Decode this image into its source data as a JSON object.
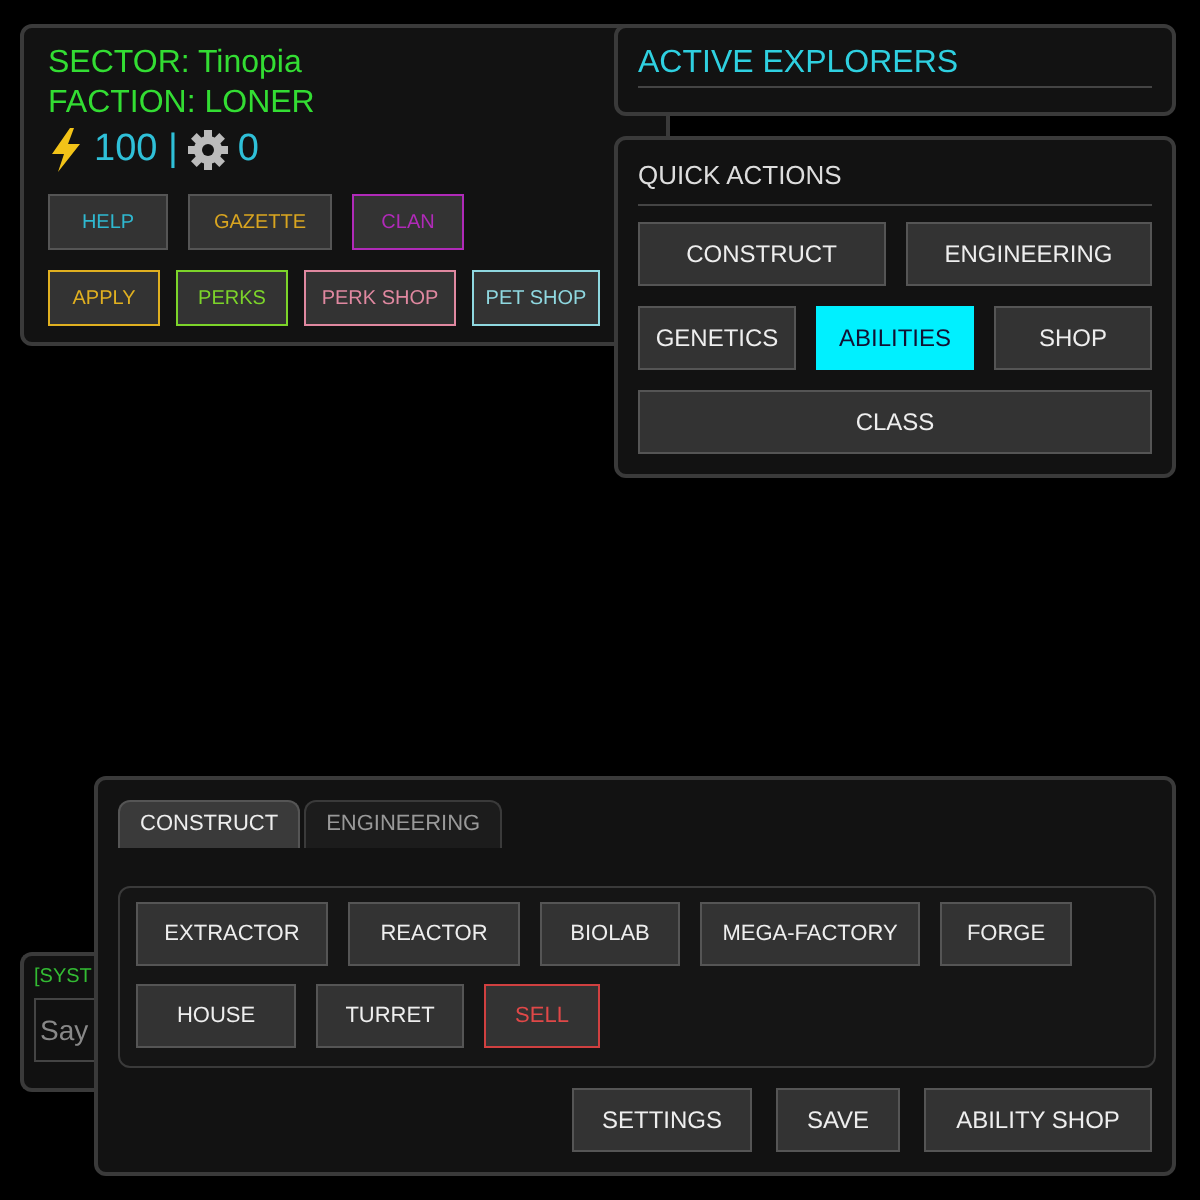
{
  "status_panel": {
    "sector": "SECTOR: Tinopia",
    "faction": "FACTION: LONER",
    "energy": "100 |",
    "gears": "0",
    "buttons": [
      {
        "label": "HELP",
        "outlined": false
      },
      {
        "label": "GAZETTE",
        "outlined": false
      },
      {
        "label": "CLAN",
        "outlined": true
      }
    ],
    "buttons_row2": [
      {
        "label": "APPLY",
        "color": "#e0b020"
      },
      {
        "label": "PERKS",
        "color": "#7cd42a"
      },
      {
        "label": "PERK SHOP",
        "color": "#e088a0"
      },
      {
        "label": "PET SHOP",
        "color": "#8fd8e0"
      }
    ]
  },
  "explorers_panel": {
    "title": "ACTIVE EXPLORERS"
  },
  "quick_actions": {
    "title": "QUICK ACTIONS",
    "buttons": [
      {
        "label": "CONSTRUCT",
        "selected": false
      },
      {
        "label": "ENGINEERING",
        "selected": false
      },
      {
        "label": "GENETICS",
        "selected": false
      },
      {
        "label": "ABILITIES",
        "selected": true
      },
      {
        "label": "SHOP",
        "selected": false
      },
      {
        "label": "CLASS",
        "selected": false
      }
    ]
  },
  "chat_panel": {
    "message": "[SYST",
    "placeholder": "Say"
  },
  "construct_panel": {
    "tabs": [
      {
        "label": "CONSTRUCT",
        "selected": true
      },
      {
        "label": "ENGINEERING",
        "selected": false
      }
    ],
    "items": [
      {
        "label": "EXTRACTOR",
        "kind": "build"
      },
      {
        "label": "REACTOR",
        "kind": "build"
      },
      {
        "label": "BIOLAB",
        "kind": "build"
      },
      {
        "label": "MEGA-FACTORY",
        "kind": "build"
      },
      {
        "label": "FORGE",
        "kind": "build"
      },
      {
        "label": "HOUSE",
        "kind": "build"
      },
      {
        "label": "TURRET",
        "kind": "build"
      },
      {
        "label": "SELL",
        "kind": "sell"
      }
    ],
    "footer_buttons": [
      "SETTINGS",
      "SAVE",
      "ABILITY SHOP"
    ]
  }
}
